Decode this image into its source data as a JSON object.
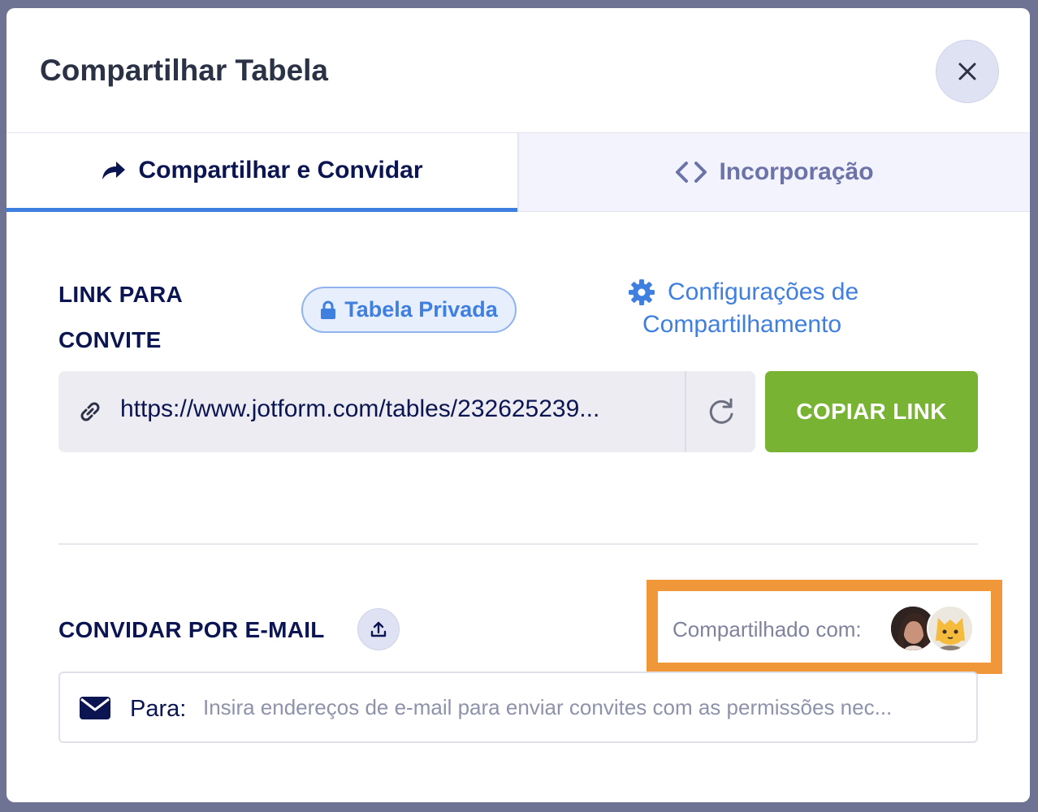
{
  "modal": {
    "title": "Compartilhar Tabela",
    "close_icon": "close-icon"
  },
  "tabs": [
    {
      "label": "Compartilhar e Convidar",
      "icon": "share-arrow-icon",
      "active": true
    },
    {
      "label": "Incorporação",
      "icon": "code-brackets-icon",
      "active": false
    }
  ],
  "invite_link": {
    "label": "LINK PARA CONVITE",
    "privacy_badge": {
      "label": "Tabela Privada",
      "icon": "lock-icon"
    },
    "settings_link": {
      "label_line1": "Configurações de",
      "label_line2": "Compartilhamento",
      "icon": "gear-icon"
    },
    "url": "https://www.jotform.com/tables/232625239...",
    "link_icon": "link-icon",
    "refresh_icon": "refresh-icon",
    "copy_button_label": "COPIAR LINK"
  },
  "email_invite": {
    "label": "CONVIDAR POR E-MAIL",
    "upload_icon": "upload-icon",
    "shared_with_label": "Compartilhado com:",
    "to_label": "Para:",
    "to_placeholder": "Insira endereços de e-mail para enviar convites com as permissões nec...",
    "mail_icon": "envelope-icon"
  },
  "colors": {
    "accent_blue": "#3f7fe0",
    "primary_text": "#0a1551",
    "copy_button": "#78b334",
    "highlight_border": "#f0973a"
  }
}
